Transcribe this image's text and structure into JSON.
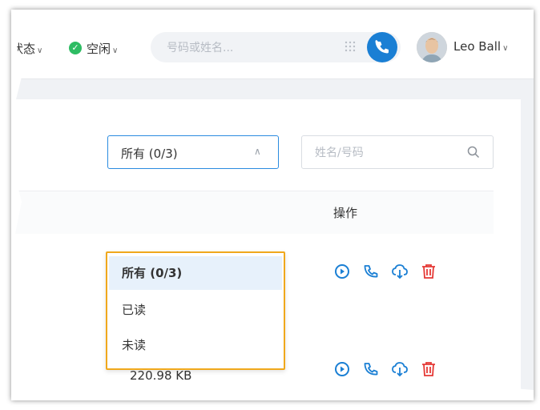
{
  "header": {
    "status_label": "状态",
    "presence_label": "空闲",
    "search_placeholder": "号码或姓名...",
    "user_name": "Leo Ball"
  },
  "filter": {
    "selected": "所有 (0/3)",
    "search_placeholder": "姓名/号码",
    "options": [
      {
        "label": "所有 (0/3)",
        "selected": true
      },
      {
        "label": "已读",
        "selected": false
      },
      {
        "label": "未读",
        "selected": false
      }
    ]
  },
  "table": {
    "ops_header": "操作",
    "rows": [
      {
        "size": ""
      },
      {
        "size": "220.98 KB"
      }
    ]
  },
  "colors": {
    "accent": "#1a7fd4",
    "presence": "#2ebc63",
    "delete": "#e53935",
    "highlight_border": "#f0a81c",
    "selected_bg": "#e7f1fb"
  },
  "icons": [
    "chevron-down-icon",
    "check-icon",
    "dialpad-icon",
    "phone-icon",
    "search-icon",
    "chevron-up-icon",
    "play-icon",
    "download-icon",
    "delete-icon"
  ]
}
